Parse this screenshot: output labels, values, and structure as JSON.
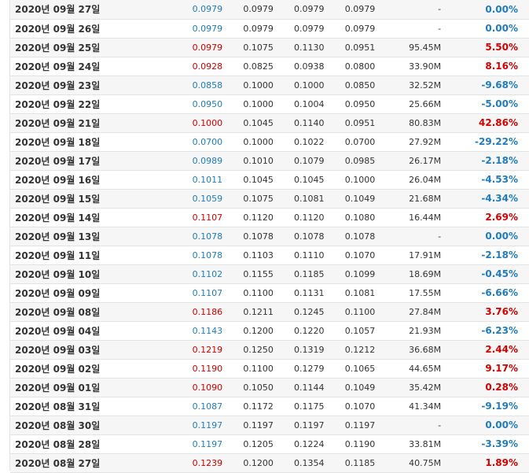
{
  "rows": [
    {
      "date": "2020년 09월 27일",
      "close": "0.0979",
      "open": "0.0979",
      "high": "0.0979",
      "low": "0.0979",
      "volume": "-",
      "change": "0.00%",
      "dir": "flat"
    },
    {
      "date": "2020년 09월 26일",
      "close": "0.0979",
      "open": "0.0979",
      "high": "0.0979",
      "low": "0.0979",
      "volume": "-",
      "change": "0.00%",
      "dir": "flat"
    },
    {
      "date": "2020년 09월 25일",
      "close": "0.0979",
      "open": "0.1075",
      "high": "0.1130",
      "low": "0.0951",
      "volume": "95.45M",
      "change": "5.50%",
      "dir": "up"
    },
    {
      "date": "2020년 09월 24일",
      "close": "0.0928",
      "open": "0.0825",
      "high": "0.0938",
      "low": "0.0800",
      "volume": "33.90M",
      "change": "8.16%",
      "dir": "up"
    },
    {
      "date": "2020년 09월 23일",
      "close": "0.0858",
      "open": "0.1000",
      "high": "0.1000",
      "low": "0.0850",
      "volume": "32.52M",
      "change": "-9.68%",
      "dir": "down"
    },
    {
      "date": "2020년 09월 22일",
      "close": "0.0950",
      "open": "0.1000",
      "high": "0.1004",
      "low": "0.0950",
      "volume": "25.66M",
      "change": "-5.00%",
      "dir": "down"
    },
    {
      "date": "2020년 09월 21일",
      "close": "0.1000",
      "open": "0.1045",
      "high": "0.1140",
      "low": "0.0951",
      "volume": "80.83M",
      "change": "42.86%",
      "dir": "up"
    },
    {
      "date": "2020년 09월 18일",
      "close": "0.0700",
      "open": "0.1000",
      "high": "0.1022",
      "low": "0.0700",
      "volume": "27.92M",
      "change": "-29.22%",
      "dir": "down"
    },
    {
      "date": "2020년 09월 17일",
      "close": "0.0989",
      "open": "0.1010",
      "high": "0.1079",
      "low": "0.0985",
      "volume": "26.17M",
      "change": "-2.18%",
      "dir": "down"
    },
    {
      "date": "2020년 09월 16일",
      "close": "0.1011",
      "open": "0.1045",
      "high": "0.1045",
      "low": "0.1000",
      "volume": "26.04M",
      "change": "-4.53%",
      "dir": "down"
    },
    {
      "date": "2020년 09월 15일",
      "close": "0.1059",
      "open": "0.1075",
      "high": "0.1081",
      "low": "0.1049",
      "volume": "21.68M",
      "change": "-4.34%",
      "dir": "down"
    },
    {
      "date": "2020년 09월 14일",
      "close": "0.1107",
      "open": "0.1120",
      "high": "0.1120",
      "low": "0.1080",
      "volume": "16.44M",
      "change": "2.69%",
      "dir": "up"
    },
    {
      "date": "2020년 09월 13일",
      "close": "0.1078",
      "open": "0.1078",
      "high": "0.1078",
      "low": "0.1078",
      "volume": "-",
      "change": "0.00%",
      "dir": "flat"
    },
    {
      "date": "2020년 09월 11일",
      "close": "0.1078",
      "open": "0.1103",
      "high": "0.1110",
      "low": "0.1070",
      "volume": "17.91M",
      "change": "-2.18%",
      "dir": "down"
    },
    {
      "date": "2020년 09월 10일",
      "close": "0.1102",
      "open": "0.1155",
      "high": "0.1185",
      "low": "0.1099",
      "volume": "18.69M",
      "change": "-0.45%",
      "dir": "down"
    },
    {
      "date": "2020년 09월 09일",
      "close": "0.1107",
      "open": "0.1100",
      "high": "0.1131",
      "low": "0.1081",
      "volume": "17.55M",
      "change": "-6.66%",
      "dir": "down"
    },
    {
      "date": "2020년 09월 08일",
      "close": "0.1186",
      "open": "0.1211",
      "high": "0.1245",
      "low": "0.1100",
      "volume": "27.84M",
      "change": "3.76%",
      "dir": "up"
    },
    {
      "date": "2020년 09월 04일",
      "close": "0.1143",
      "open": "0.1200",
      "high": "0.1220",
      "low": "0.1057",
      "volume": "21.93M",
      "change": "-6.23%",
      "dir": "down"
    },
    {
      "date": "2020년 09월 03일",
      "close": "0.1219",
      "open": "0.1250",
      "high": "0.1319",
      "low": "0.1212",
      "volume": "36.68M",
      "change": "2.44%",
      "dir": "up"
    },
    {
      "date": "2020년 09월 02일",
      "close": "0.1190",
      "open": "0.1100",
      "high": "0.1279",
      "low": "0.1065",
      "volume": "44.65M",
      "change": "9.17%",
      "dir": "up"
    },
    {
      "date": "2020년 09월 01일",
      "close": "0.1090",
      "open": "0.1050",
      "high": "0.1144",
      "low": "0.1049",
      "volume": "35.42M",
      "change": "0.28%",
      "dir": "up"
    },
    {
      "date": "2020년 08월 31일",
      "close": "0.1087",
      "open": "0.1172",
      "high": "0.1175",
      "low": "0.1070",
      "volume": "41.34M",
      "change": "-9.19%",
      "dir": "down"
    },
    {
      "date": "2020년 08월 30일",
      "close": "0.1197",
      "open": "0.1197",
      "high": "0.1197",
      "low": "0.1197",
      "volume": "-",
      "change": "0.00%",
      "dir": "flat"
    },
    {
      "date": "2020년 08월 28일",
      "close": "0.1197",
      "open": "0.1205",
      "high": "0.1224",
      "low": "0.1190",
      "volume": "33.81M",
      "change": "-3.39%",
      "dir": "down"
    },
    {
      "date": "2020년 08월 27일",
      "close": "0.1239",
      "open": "0.1200",
      "high": "0.1354",
      "low": "0.1185",
      "volume": "40.75M",
      "change": "1.89%",
      "dir": "up"
    }
  ],
  "colors": {
    "up": "#d60000",
    "down": "#1f7cc2",
    "flat": "#1f7cc2",
    "row_alt_bg": "#f6f6f6",
    "border": "#e3e3e3"
  }
}
